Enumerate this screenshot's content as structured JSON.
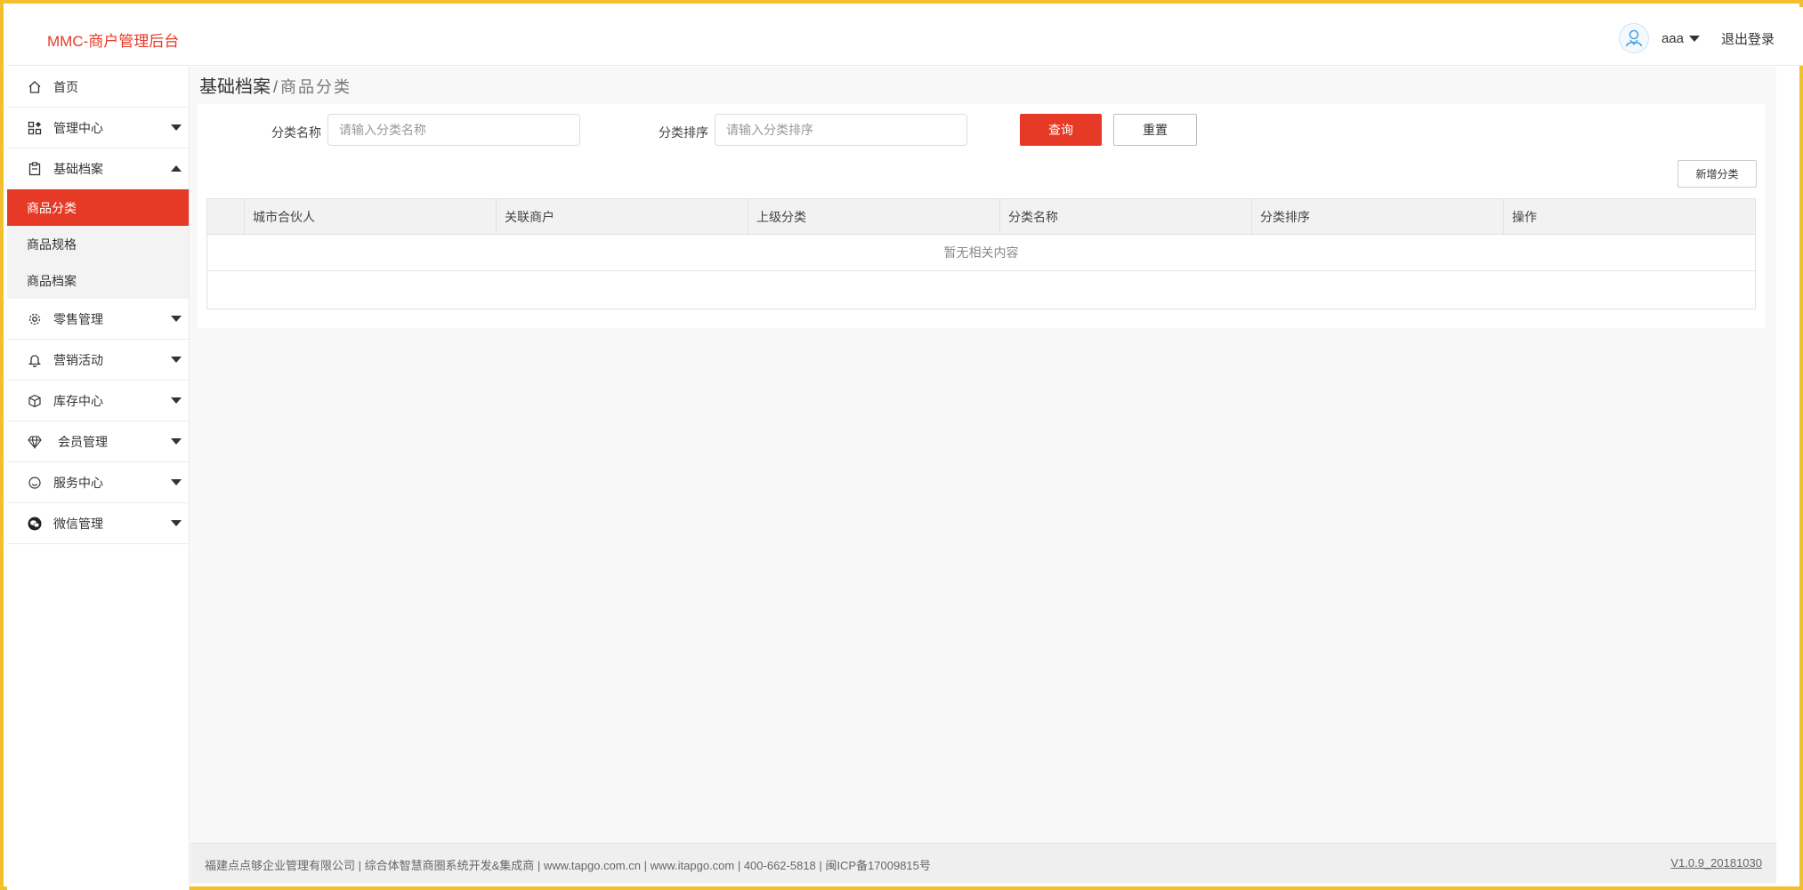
{
  "header": {
    "brand": "MMC-商户管理后台",
    "username": "aaa",
    "logout": "退出登录"
  },
  "sidebar": {
    "items": [
      {
        "label": "首页",
        "icon": "home-icon"
      },
      {
        "label": "管理中心",
        "icon": "grid-icon"
      },
      {
        "label": "基础档案",
        "icon": "clipboard-icon"
      },
      {
        "label": "零售管理",
        "icon": "gear-icon"
      },
      {
        "label": "营销活动",
        "icon": "bell-icon"
      },
      {
        "label": "库存中心",
        "icon": "box-icon"
      },
      {
        "label": "会员管理",
        "icon": "diamond-icon"
      },
      {
        "label": "服务中心",
        "icon": "smile-icon"
      },
      {
        "label": "微信管理",
        "icon": "wechat-icon"
      }
    ],
    "submenu": [
      "商品分类",
      "商品规格",
      "商品档案"
    ],
    "active_submenu": "商品分类"
  },
  "breadcrumb": {
    "parent": "基础档案",
    "separator": "/",
    "current": "商品分类"
  },
  "filters": {
    "name_label": "分类名称",
    "name_placeholder": "请输入分类名称",
    "sort_label": "分类排序",
    "sort_placeholder": "请输入分类排序",
    "query_button": "查询",
    "reset_button": "重置"
  },
  "actions": {
    "add_button": "新增分类"
  },
  "table": {
    "columns": [
      "",
      "城市合伙人",
      "关联商户",
      "上级分类",
      "分类名称",
      "分类排序",
      "操作"
    ],
    "empty_text": "暂无相关内容"
  },
  "footer": {
    "text": "福建点点够企业管理有限公司 | 综合体智慧商圈系统开发&集成商 | www.tapgo.com.cn | www.itapgo.com | 400-662-5818 | 闽ICP备17009815号",
    "version": "V1.0.9_20181030"
  },
  "colors": {
    "accent": "#e63a26",
    "frame": "#f2c02c"
  }
}
